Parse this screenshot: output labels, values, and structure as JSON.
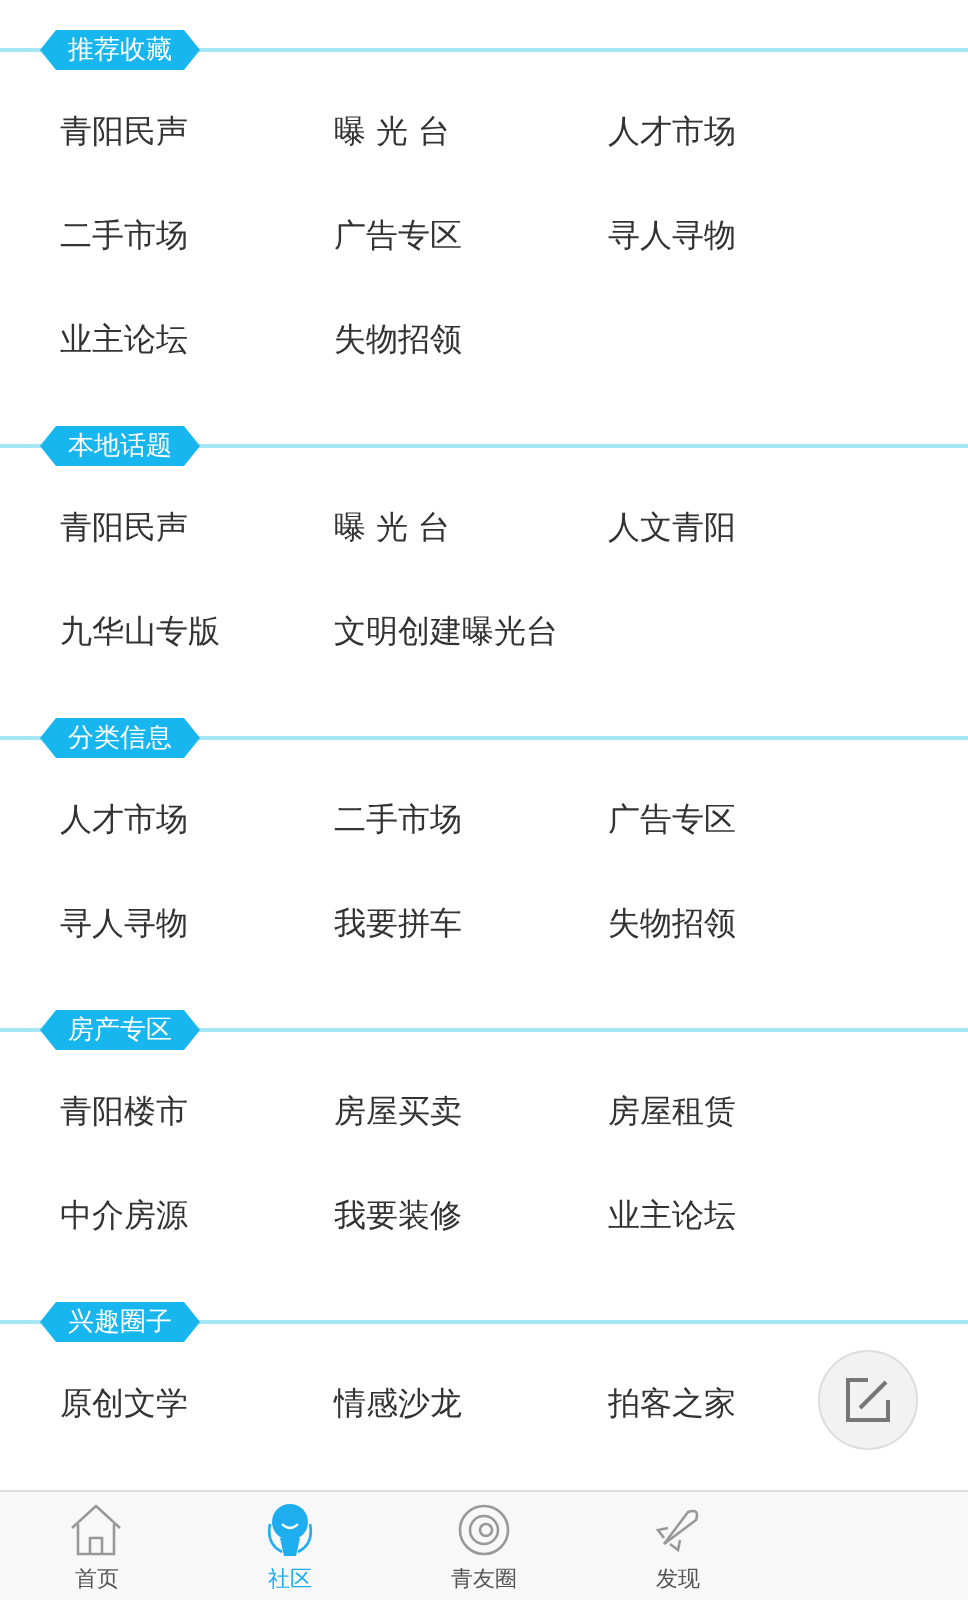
{
  "sections": [
    {
      "title": "推荐收藏",
      "items": [
        "青阳民声",
        "曝 光 台",
        "人才市场",
        "二手市场",
        "广告专区",
        "寻人寻物",
        "业主论坛",
        "失物招领"
      ]
    },
    {
      "title": "本地话题",
      "items": [
        "青阳民声",
        "曝 光 台",
        "人文青阳",
        "九华山专版",
        "文明创建曝光台"
      ]
    },
    {
      "title": "分类信息",
      "items": [
        "人才市场",
        "二手市场",
        "广告专区",
        "寻人寻物",
        "我要拼车",
        "失物招领"
      ]
    },
    {
      "title": "房产专区",
      "items": [
        "青阳楼市",
        "房屋买卖",
        "房屋租赁",
        "中介房源",
        "我要装修",
        "业主论坛"
      ]
    },
    {
      "title": "兴趣圈子",
      "items": [
        "原创文学",
        "情感沙龙",
        "拍客之家"
      ]
    }
  ],
  "tab_bar": [
    {
      "kind": "home",
      "label": "首页",
      "selected": false
    },
    {
      "kind": "community",
      "label": "社区",
      "selected": true
    },
    {
      "kind": "friends",
      "label": "青友圈",
      "selected": false
    },
    {
      "kind": "discover",
      "label": "发现",
      "selected": false
    }
  ]
}
